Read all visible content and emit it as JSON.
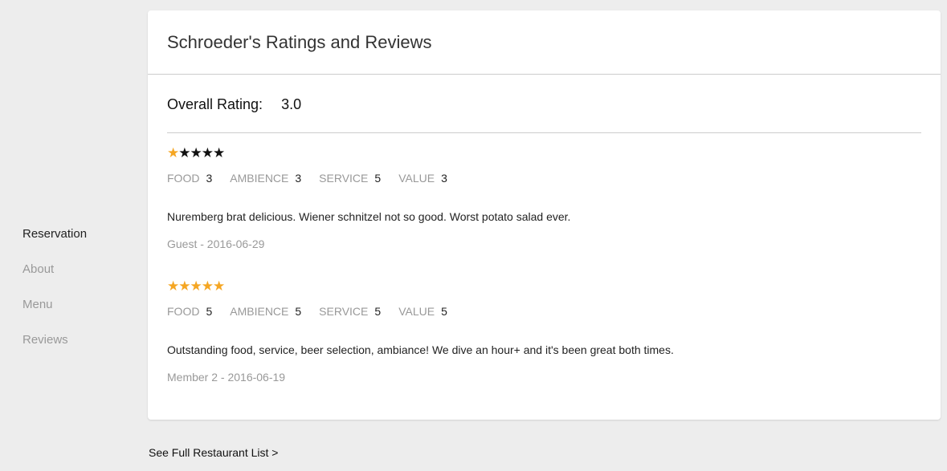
{
  "nav": {
    "items": [
      {
        "label": "Reservation",
        "active": true
      },
      {
        "label": "About"
      },
      {
        "label": "Menu"
      },
      {
        "label": "Reviews"
      }
    ]
  },
  "card": {
    "title": "Schroeder's Ratings and Reviews",
    "overall_label": "Overall Rating:",
    "overall_value": "3.0"
  },
  "reviews": [
    {
      "stars": 1,
      "max_stars": 5,
      "food_label": "FOOD",
      "food": "3",
      "ambience_label": "AMBIENCE",
      "ambience": "3",
      "service_label": "SERVICE",
      "service": "5",
      "value_label": "VALUE",
      "value": "3",
      "text": "Nuremberg brat delicious. Wiener schnitzel not so good. Worst potato salad ever.",
      "author": "Guest - 2016-06-29"
    },
    {
      "stars": 5,
      "max_stars": 5,
      "food_label": "FOOD",
      "food": "5",
      "ambience_label": "AMBIENCE",
      "ambience": "5",
      "service_label": "SERVICE",
      "service": "5",
      "value_label": "VALUE",
      "value": "5",
      "text": "Outstanding food, service, beer selection, ambiance! We dive an hour+ and it's been great both times.",
      "author": "Member 2 - 2016-06-19"
    }
  ],
  "colors": {
    "star_on": "#f5a623",
    "star_off": "#111111"
  },
  "footer": {
    "full_list_link": "See Full Restaurant List >"
  }
}
